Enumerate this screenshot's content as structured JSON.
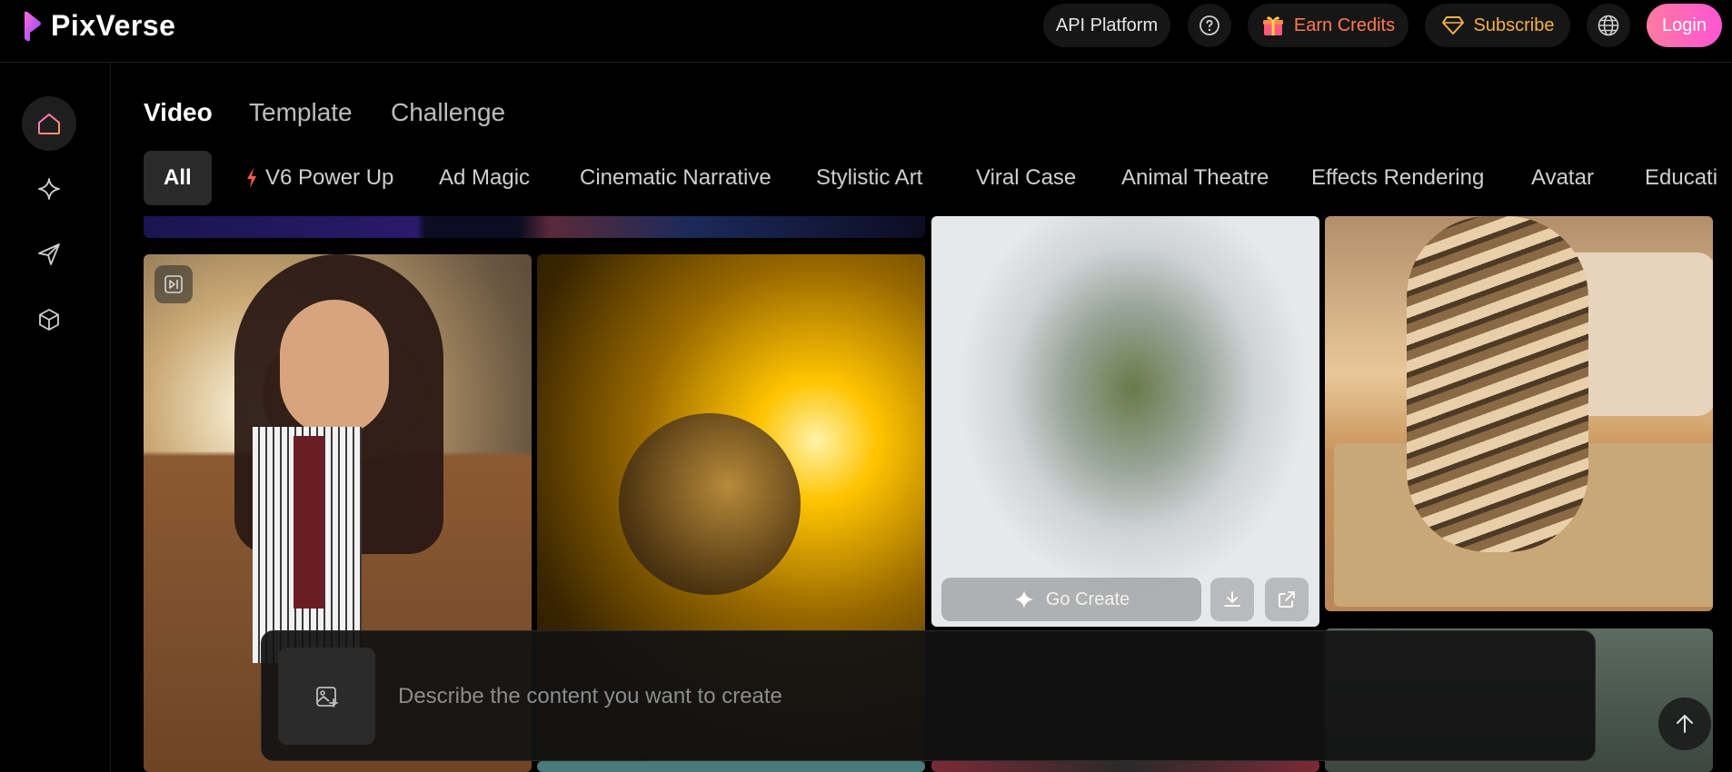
{
  "header": {
    "brand": "PixVerse",
    "api_platform": "API Platform",
    "earn_credits": "Earn Credits",
    "subscribe": "Subscribe",
    "login": "Login"
  },
  "sidebar": {
    "items": [
      {
        "icon": "home-icon",
        "active": true
      },
      {
        "icon": "sparkle-icon",
        "active": false
      },
      {
        "icon": "send-icon",
        "active": false
      },
      {
        "icon": "cube-icon",
        "active": false
      }
    ]
  },
  "tabs": [
    {
      "label": "Video",
      "active": true
    },
    {
      "label": "Template",
      "active": false
    },
    {
      "label": "Challenge",
      "active": false
    }
  ],
  "categories": [
    "All",
    "V6 Power Up",
    "Ad Magic",
    "Cinematic Narrative",
    "Stylistic Art",
    "Viral Case",
    "Animal Theatre",
    "Effects Rendering",
    "Avatar",
    "Educati"
  ],
  "card_actions": {
    "go_create": "Go Create"
  },
  "prompt": {
    "placeholder": "Describe the content you want to create"
  },
  "colors": {
    "accent_pink": "#ff55d4",
    "earn_orange": "#ff7a4d",
    "subscribe_gold": "#f5b14a"
  }
}
